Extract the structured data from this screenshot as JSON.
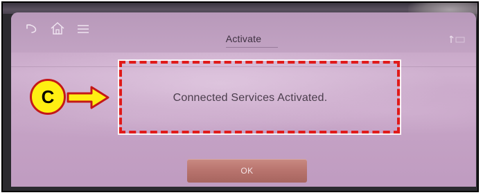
{
  "screen": {
    "title": "Activate",
    "message": "Connected Services Activated.",
    "ok_label": "OK",
    "icons": [
      "back-icon",
      "home-icon",
      "menu-icon",
      "status-icons"
    ]
  },
  "annotation": {
    "badge_label": "C",
    "colors": {
      "highlight": "#e01a1a",
      "badge_fill": "#ffef12",
      "arrow_fill": "#ffef12",
      "arrow_outline": "#c41818"
    }
  },
  "theme": {
    "screen_bg": "#c8a8c8",
    "ok_button": "#b8736d"
  }
}
